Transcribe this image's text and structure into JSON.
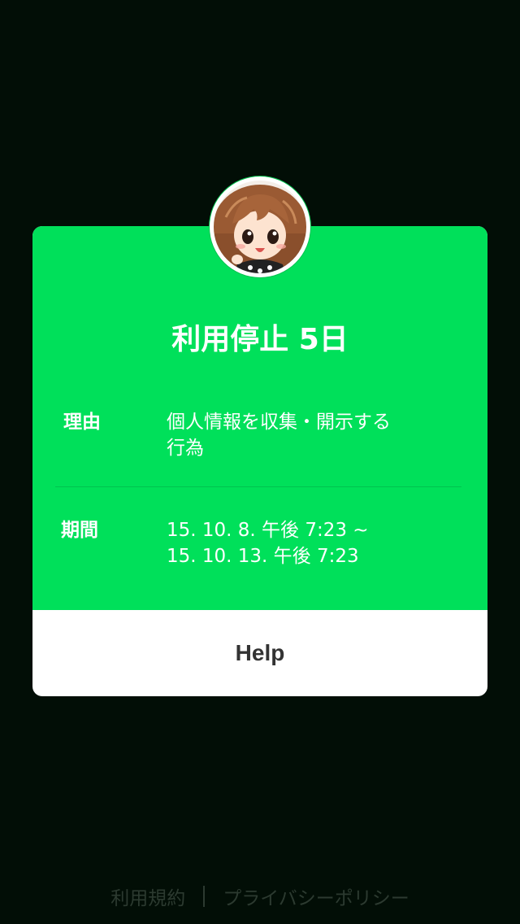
{
  "dialog": {
    "title": "利用停止 5日",
    "reason": {
      "label": "理由",
      "lines": [
        "個人情報を収集・開示する",
        "行為"
      ]
    },
    "period": {
      "label": "期間",
      "lines": [
        "15. 10. 8. 午後 7:23 ~",
        "15. 10. 13. 午後 7:23"
      ]
    },
    "help_label": "Help",
    "accent_color": "#00e05a"
  },
  "footer": {
    "terms_label": "利用規約",
    "privacy_label": "プライバシーポリシー"
  },
  "icons": {
    "avatar": "cartoon-girl-avatar-icon"
  },
  "colors": {
    "background": "#020e06",
    "card_green": "#00e05a",
    "button_bg": "#ffffff",
    "footer_text": "#2c3a30"
  }
}
